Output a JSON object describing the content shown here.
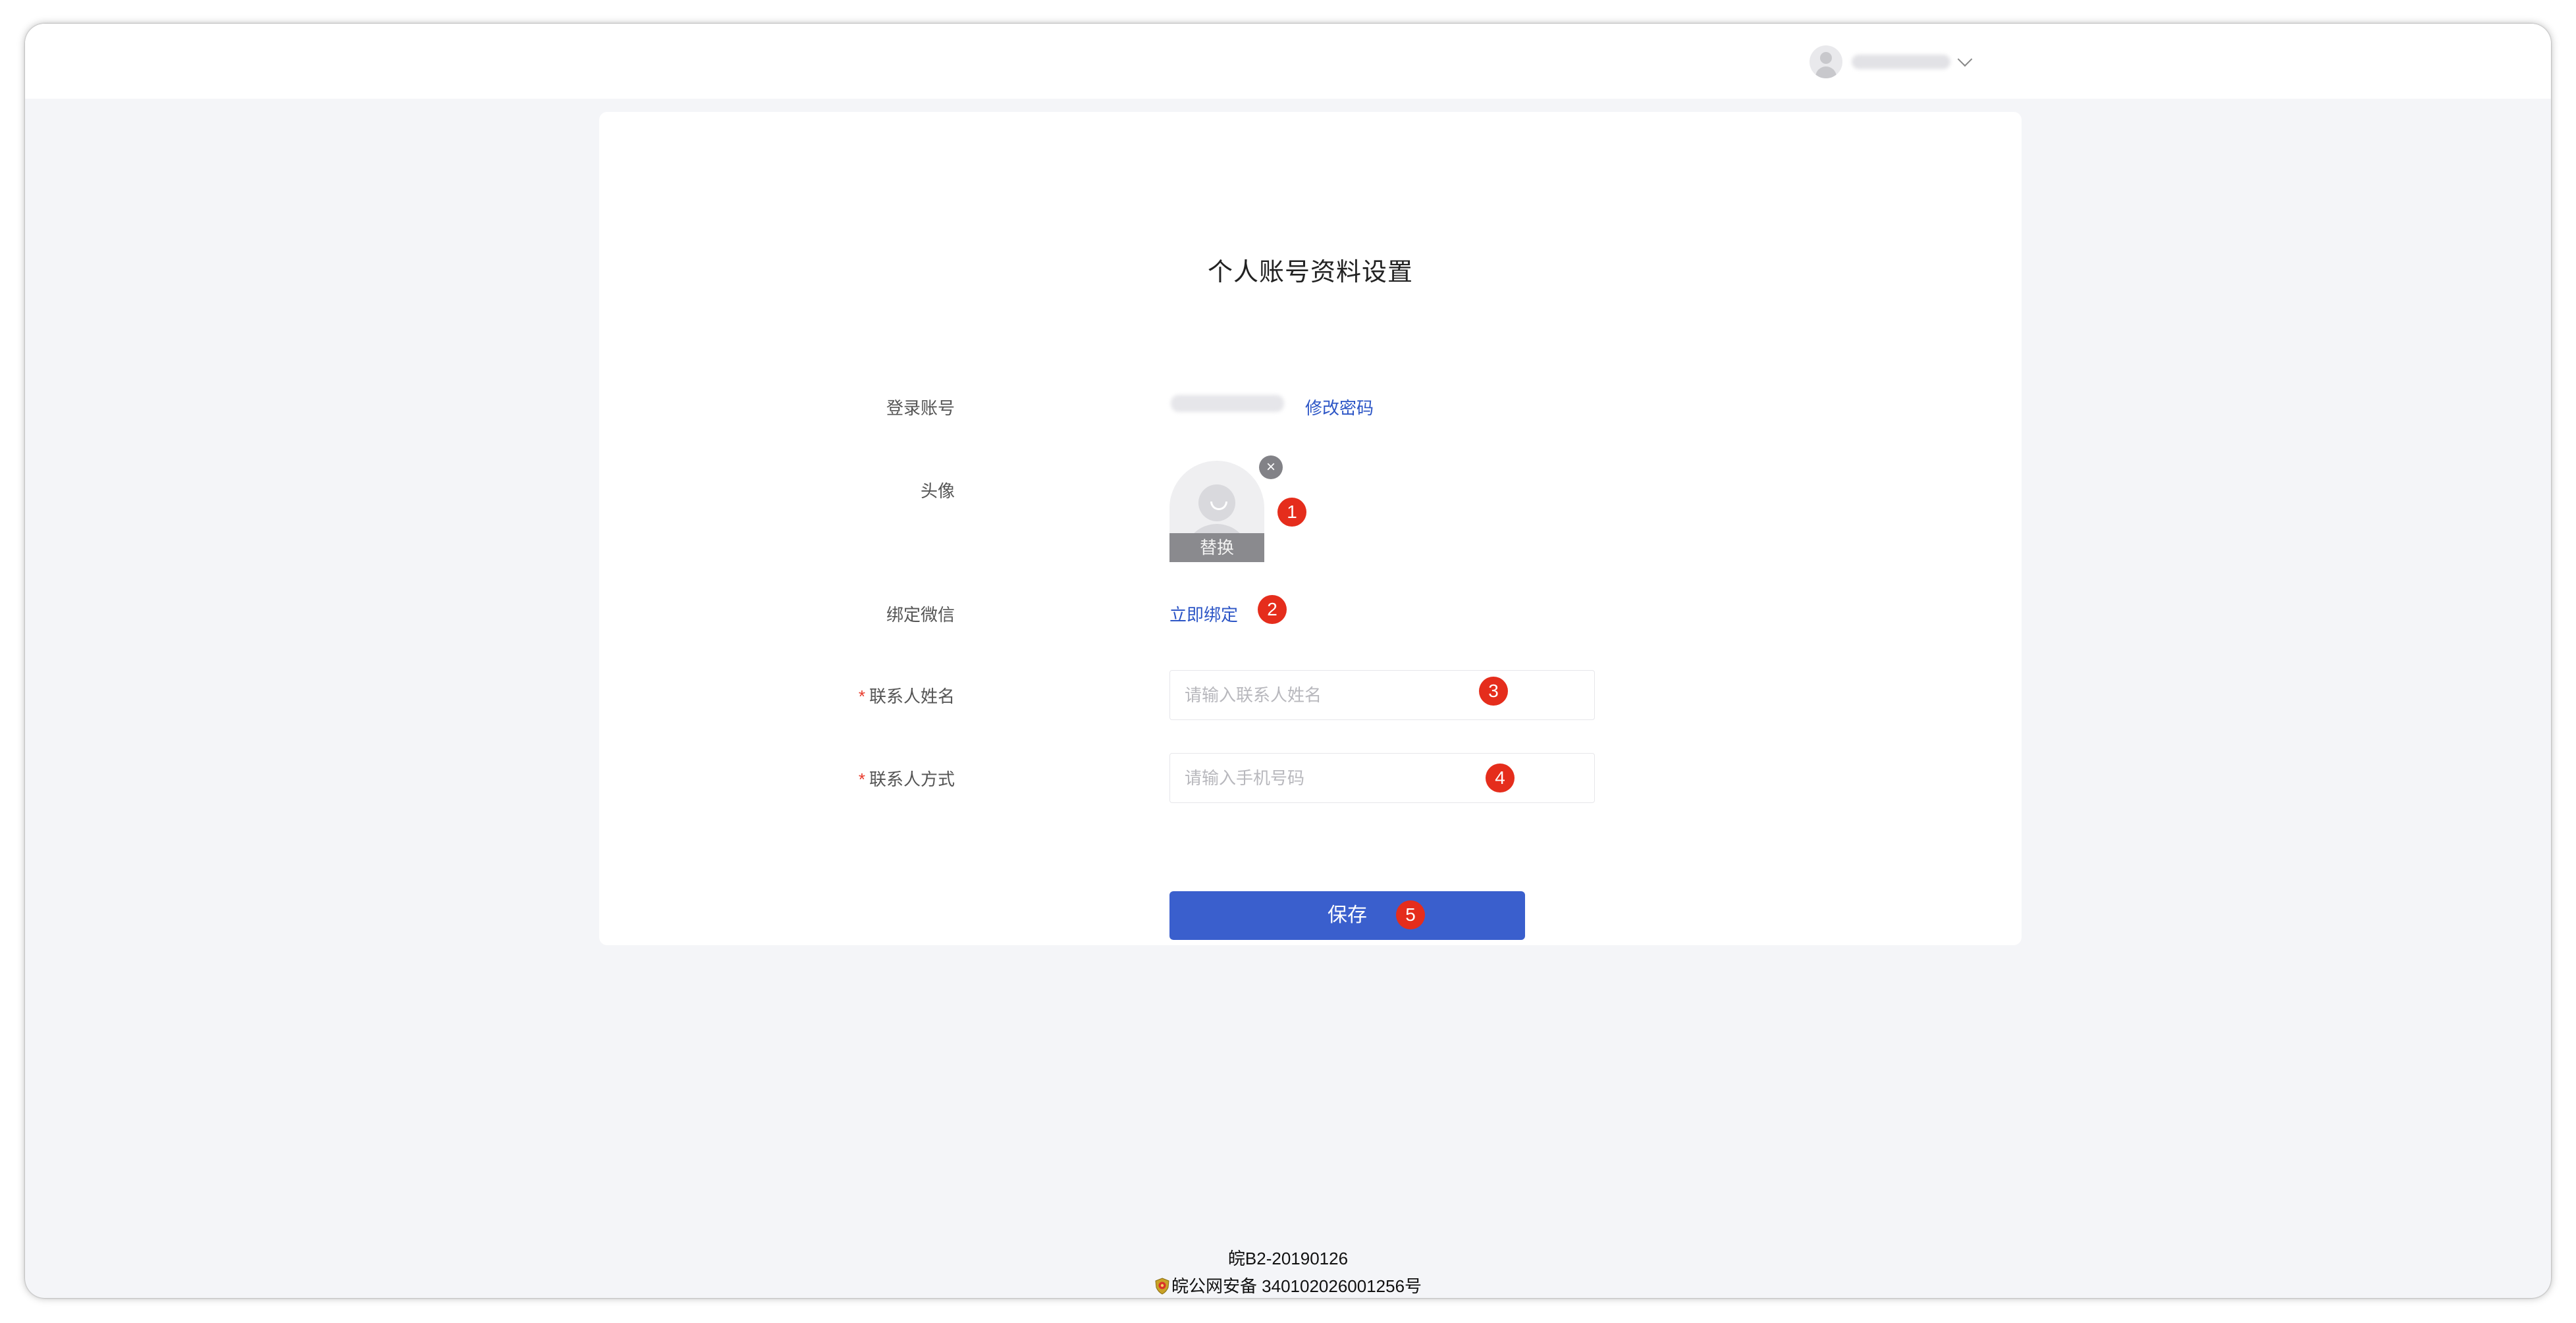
{
  "header": {
    "user_menu": {
      "avatar_icon": "user-avatar-icon",
      "dropdown_icon": "chevron-down-icon"
    }
  },
  "form": {
    "title": "个人账号资料设置",
    "account": {
      "label": "登录账号",
      "change_password_link": "修改密码"
    },
    "avatar": {
      "label": "头像",
      "replace_label": "替换",
      "remove_symbol": "×",
      "placeholder_icon": "default-avatar-icon"
    },
    "wechat": {
      "label": "绑定微信",
      "bind_link": "立即绑定"
    },
    "contact_name": {
      "required_mark": "*",
      "label": "联系人姓名",
      "placeholder": "请输入联系人姓名",
      "value": ""
    },
    "contact_phone": {
      "required_mark": "*",
      "label": "联系人方式",
      "placeholder": "请输入手机号码",
      "value": ""
    },
    "save_label": "保存"
  },
  "annotations": [
    "1",
    "2",
    "3",
    "4",
    "5"
  ],
  "footer": {
    "icp": "皖B2-20190126",
    "police_record": "皖公网安备 340102026001256号",
    "police_icon": "police-badge-icon"
  },
  "colors": {
    "accent": "#3a5fcd",
    "link": "#2d56c6",
    "annotation_badge": "#e52d1c",
    "required": "#e8392a",
    "page_background": "#f4f5f8"
  }
}
